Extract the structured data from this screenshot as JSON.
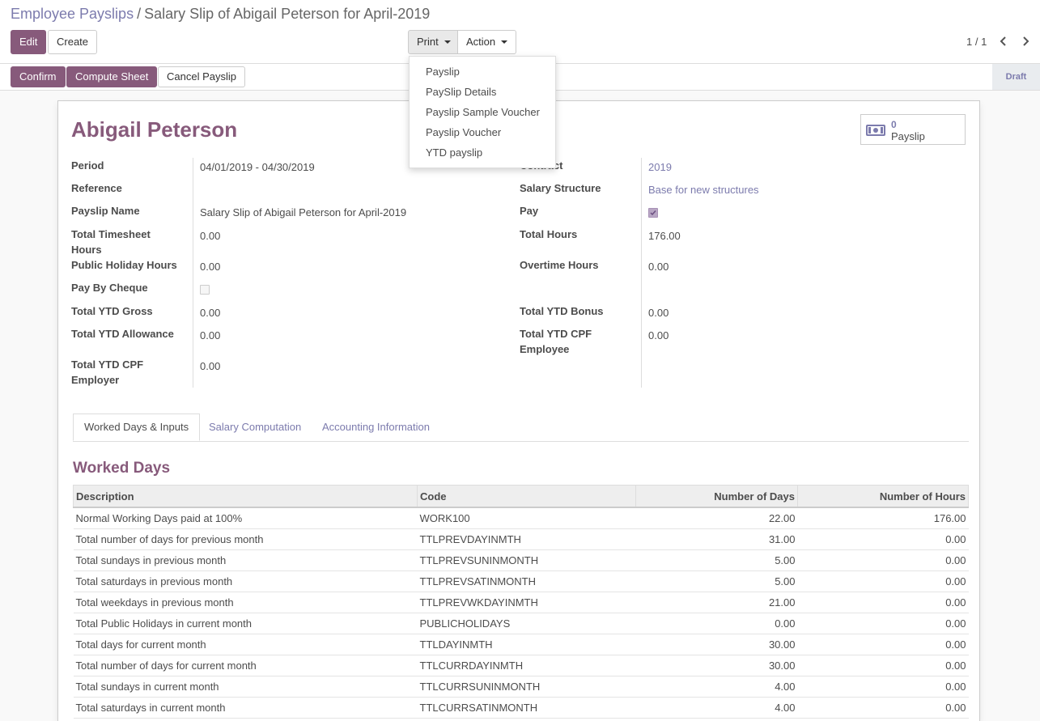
{
  "breadcrumb": {
    "parent": "Employee Payslips",
    "separator": "/",
    "current": "Salary Slip of Abigail Peterson for April-2019"
  },
  "toolbar": {
    "edit": "Edit",
    "create": "Create",
    "print": "Print",
    "action": "Action"
  },
  "pager": {
    "value": "1 / 1"
  },
  "statusbar": {
    "confirm": "Confirm",
    "compute": "Compute Sheet",
    "cancel": "Cancel Payslip",
    "state": "Draft"
  },
  "print_menu": [
    "Payslip",
    "PaySlip Details",
    "Payslip Sample Voucher",
    "Payslip Voucher",
    "YTD payslip"
  ],
  "sheet": {
    "employee_name": "Abigail Peterson",
    "smart_button": {
      "count": "0",
      "label": "Payslip"
    },
    "left": {
      "period_label": "Period",
      "period_value": "04/01/2019 - 04/30/2019",
      "reference_label": "Reference",
      "reference_value": "",
      "payslip_name_label": "Payslip Name",
      "payslip_name_value": "Salary Slip of Abigail Peterson for April-2019",
      "timesheet_label_1": "Total Timesheet",
      "timesheet_label_2": "Hours",
      "timesheet_value": "0.00",
      "public_holiday_label": "Public Holiday Hours",
      "public_holiday_value": "0.00",
      "cheque_label": "Pay By Cheque",
      "cheque_checked": false,
      "ytd_gross_label": "Total YTD Gross",
      "ytd_gross_value": "0.00",
      "ytd_allowance_label": "Total YTD Allowance",
      "ytd_allowance_value": "0.00",
      "cpf_employer_label_1": "Total YTD CPF",
      "cpf_employer_label_2": "Employer",
      "cpf_employer_value": "0.00"
    },
    "right": {
      "contract_label": "Contract",
      "contract_value": "2019",
      "structure_label": "Salary Structure",
      "structure_value": "Base for new structures",
      "pay_label": "Pay",
      "pay_checked": true,
      "total_hours_label": "Total Hours",
      "total_hours_value": "176.00",
      "overtime_label": "Overtime Hours",
      "overtime_value": "0.00",
      "ytd_bonus_label": "Total YTD Bonus",
      "ytd_bonus_value": "0.00",
      "cpf_employee_label_1": "Total YTD CPF",
      "cpf_employee_label_2": "Employee",
      "cpf_employee_value": "0.00"
    },
    "tabs": [
      "Worked Days & Inputs",
      "Salary Computation",
      "Accounting Information"
    ],
    "section_title": "Worked Days",
    "table": {
      "headers": [
        "Description",
        "Code",
        "Number of Days",
        "Number of Hours"
      ],
      "rows": [
        [
          "Normal Working Days paid at 100%",
          "WORK100",
          "22.00",
          "176.00"
        ],
        [
          "Total number of days for previous month",
          "TTLPREVDAYINMTH",
          "31.00",
          "0.00"
        ],
        [
          "Total sundays in previous month",
          "TTLPREVSUNINMONTH",
          "5.00",
          "0.00"
        ],
        [
          "Total saturdays in previous month",
          "TTLPREVSATINMONTH",
          "5.00",
          "0.00"
        ],
        [
          "Total weekdays in previous month",
          "TTLPREVWKDAYINMTH",
          "21.00",
          "0.00"
        ],
        [
          "Total Public Holidays in current month",
          "PUBLICHOLIDAYS",
          "0.00",
          "0.00"
        ],
        [
          "Total days for current month",
          "TTLDAYINMTH",
          "30.00",
          "0.00"
        ],
        [
          "Total number of days for current month",
          "TTLCURRDAYINMTH",
          "30.00",
          "0.00"
        ],
        [
          "Total sundays in current month",
          "TTLCURRSUNINMONTH",
          "4.00",
          "0.00"
        ],
        [
          "Total saturdays in current month",
          "TTLCURRSATINMONTH",
          "4.00",
          "0.00"
        ]
      ]
    }
  },
  "colors": {
    "accent": "#875a7b",
    "link": "#7c7bad"
  }
}
